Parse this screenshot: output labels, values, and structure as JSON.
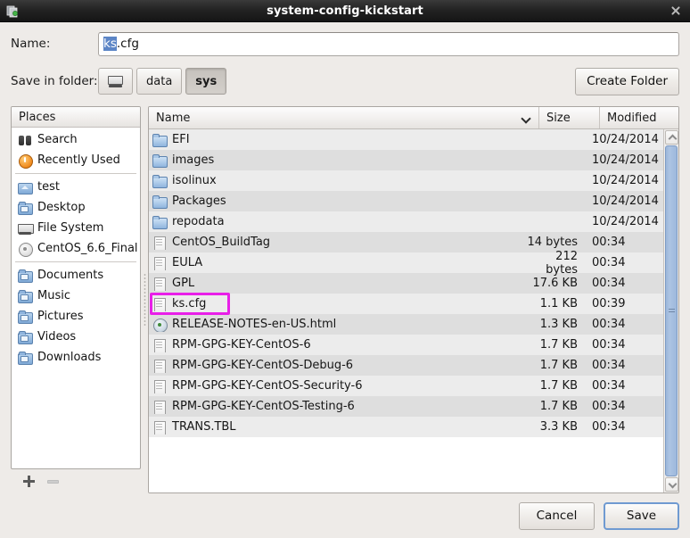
{
  "window": {
    "title": "system-config-kickstart",
    "app_icon": "app-icon",
    "close_icon": "close-icon"
  },
  "form": {
    "name_label": "Name:",
    "name_value_selected": "ks",
    "name_value_rest": ".cfg",
    "name_value_full": "ks.cfg",
    "save_in_folder_label": "Save in folder:",
    "create_folder_label": "Create Folder",
    "path_buttons": [
      {
        "label": "",
        "icon": "drive-icon",
        "active": false
      },
      {
        "label": "data",
        "icon": "",
        "active": false
      },
      {
        "label": "sys",
        "icon": "",
        "active": true
      }
    ]
  },
  "sidebar": {
    "header": "Places",
    "groups": [
      [
        {
          "label": "Search",
          "icon": "binoculars-icon"
        },
        {
          "label": "Recently Used",
          "icon": "recent-clock-icon"
        }
      ],
      [
        {
          "label": "test",
          "icon": "home-folder-icon"
        },
        {
          "label": "Desktop",
          "icon": "desktop-folder-icon"
        },
        {
          "label": "File System",
          "icon": "drive-monitor-icon"
        },
        {
          "label": "CentOS_6.6_Final",
          "icon": "disc-icon"
        }
      ],
      [
        {
          "label": "Documents",
          "icon": "documents-folder-icon"
        },
        {
          "label": "Music",
          "icon": "music-folder-icon"
        },
        {
          "label": "Pictures",
          "icon": "pictures-folder-icon"
        },
        {
          "label": "Videos",
          "icon": "videos-folder-icon"
        },
        {
          "label": "Downloads",
          "icon": "downloads-folder-icon"
        }
      ]
    ],
    "add_bookmark_icon": "plus-icon",
    "remove_bookmark_icon": "minus-icon"
  },
  "filelist": {
    "columns": [
      "Name",
      "Size",
      "Modified"
    ],
    "sort_column": "Name",
    "sort_icon": "chevron-down-icon",
    "rows": [
      {
        "name": "EFI",
        "icon": "folder-icon",
        "size": "",
        "modified": "10/24/2014"
      },
      {
        "name": "images",
        "icon": "folder-icon",
        "size": "",
        "modified": "10/24/2014"
      },
      {
        "name": "isolinux",
        "icon": "folder-icon",
        "size": "",
        "modified": "10/24/2014"
      },
      {
        "name": "Packages",
        "icon": "folder-icon",
        "size": "",
        "modified": "10/24/2014"
      },
      {
        "name": "repodata",
        "icon": "folder-icon",
        "size": "",
        "modified": "10/24/2014"
      },
      {
        "name": "CentOS_BuildTag",
        "icon": "document-icon",
        "size": "14 bytes",
        "modified": "00:34"
      },
      {
        "name": "EULA",
        "icon": "document-icon",
        "size": "212 bytes",
        "modified": "00:34"
      },
      {
        "name": "GPL",
        "icon": "document-icon",
        "size": "17.6 KB",
        "modified": "00:34"
      },
      {
        "name": "ks.cfg",
        "icon": "document-icon",
        "size": "1.1 KB",
        "modified": "00:39",
        "highlighted": true
      },
      {
        "name": "RELEASE-NOTES-en-US.html",
        "icon": "html-icon",
        "size": "1.3 KB",
        "modified": "00:34"
      },
      {
        "name": "RPM-GPG-KEY-CentOS-6",
        "icon": "document-icon",
        "size": "1.7 KB",
        "modified": "00:34"
      },
      {
        "name": "RPM-GPG-KEY-CentOS-Debug-6",
        "icon": "document-icon",
        "size": "1.7 KB",
        "modified": "00:34"
      },
      {
        "name": "RPM-GPG-KEY-CentOS-Security-6",
        "icon": "document-icon",
        "size": "1.7 KB",
        "modified": "00:34"
      },
      {
        "name": "RPM-GPG-KEY-CentOS-Testing-6",
        "icon": "document-icon",
        "size": "1.7 KB",
        "modified": "00:34"
      },
      {
        "name": "TRANS.TBL",
        "icon": "document-icon",
        "size": "3.3 KB",
        "modified": "00:34"
      }
    ],
    "scrollbar": {
      "up_icon": "scroll-up-arrow-icon",
      "down_icon": "scroll-down-arrow-icon"
    }
  },
  "footer": {
    "cancel_label": "Cancel",
    "save_label": "Save"
  },
  "colors": {
    "accent_selection": "#5c85c6",
    "highlight_annotation": "#e81fe8",
    "scrollbar_thumb": "#9db8dc",
    "row_odd": "#ececec",
    "row_even": "#dedede"
  }
}
